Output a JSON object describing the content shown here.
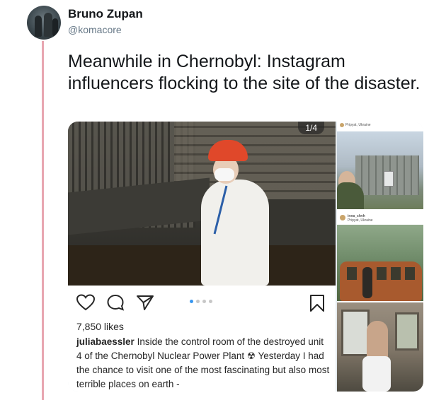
{
  "tweet": {
    "author_name": "Bruno Zupan",
    "author_handle": "@komacore",
    "text": "Meanwhile in Chernobyl: Instagram influencers flocking to the site of the disaster."
  },
  "instagram_post": {
    "counter": "1/4",
    "likes": "7,850 likes",
    "caption_user": "juliabaessler",
    "caption_text": " Inside the control room of the destroyed unit 4 of the Chernobyl Nuclear Power Plant ☢ Yesterday I had the chance to visit one of the most fascinating but also most terrible places on earth -",
    "carousel_dots": 4,
    "active_dot": 0
  },
  "side_posts": [
    {
      "location": "Pripyat, Ukraine"
    },
    {
      "username": "inna_shvh",
      "location": "Pripyat, Ukraine"
    }
  ],
  "colors": {
    "thread_line": "#e8a6b1",
    "handle": "#657786",
    "accent_dot": "#3897f0"
  }
}
